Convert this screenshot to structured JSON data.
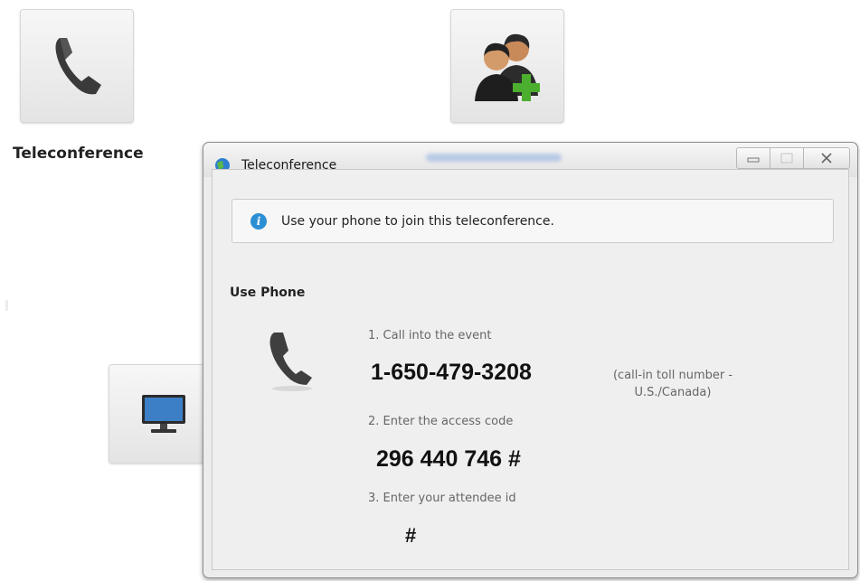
{
  "background": {
    "tile_caption": "Teleconference",
    "tiles": [
      {
        "icon": "phone-icon"
      },
      {
        "icon": "add-people-icon"
      },
      {
        "icon": "monitor-icon"
      }
    ]
  },
  "dialog": {
    "title": "Teleconference",
    "title_icon": "globe-icon",
    "window_buttons": [
      "minimize",
      "maximize",
      "close"
    ],
    "info_message": "Use your phone to join this teleconference.",
    "section_title": "Use Phone",
    "steps": {
      "step1": "1. Call into the event",
      "phone_number": "1-650-479-3208",
      "toll_note_line1": "(call-in toll number -",
      "toll_note_line2": "U.S./Canada)",
      "step2": "2. Enter the access code",
      "access_code": "296 440 746 #",
      "step3": "3. Enter your attendee id",
      "attendee_placeholder": "#"
    }
  },
  "colors": {
    "info_icon": "#2c8fd3",
    "add_plus": "#4cae2f",
    "dialog_bg": "#ececec"
  }
}
